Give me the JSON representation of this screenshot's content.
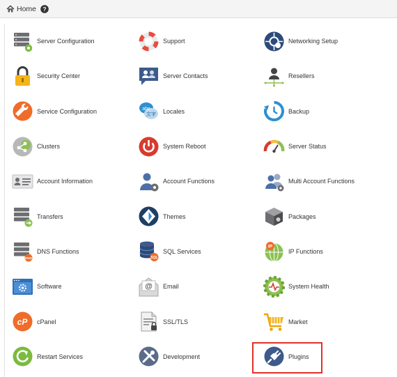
{
  "breadcrumb": {
    "home_label": "Home"
  },
  "highlight_color": "#e32f26",
  "tiles": [
    {
      "label": "Server Configuration",
      "icon": "server-config-icon"
    },
    {
      "label": "Support",
      "icon": "lifebuoy-icon"
    },
    {
      "label": "Networking Setup",
      "icon": "networking-icon"
    },
    {
      "label": "Security Center",
      "icon": "padlock-icon"
    },
    {
      "label": "Server Contacts",
      "icon": "contacts-chat-icon"
    },
    {
      "label": "Resellers",
      "icon": "resellers-icon"
    },
    {
      "label": "Service Configuration",
      "icon": "wrench-icon"
    },
    {
      "label": "Locales",
      "icon": "locales-icon"
    },
    {
      "label": "Backup",
      "icon": "backup-icon"
    },
    {
      "label": "Clusters",
      "icon": "clusters-icon"
    },
    {
      "label": "System Reboot",
      "icon": "power-icon"
    },
    {
      "label": "Server Status",
      "icon": "gauge-icon"
    },
    {
      "label": "Account Information",
      "icon": "account-card-icon"
    },
    {
      "label": "Account Functions",
      "icon": "user-gear-icon"
    },
    {
      "label": "Multi Account Functions",
      "icon": "multi-users-icon"
    },
    {
      "label": "Transfers",
      "icon": "transfers-icon"
    },
    {
      "label": "Themes",
      "icon": "themes-icon"
    },
    {
      "label": "Packages",
      "icon": "package-icon"
    },
    {
      "label": "DNS Functions",
      "icon": "dns-icon"
    },
    {
      "label": "SQL Services",
      "icon": "database-icon"
    },
    {
      "label": "IP Functions",
      "icon": "globe-ip-icon"
    },
    {
      "label": "Software",
      "icon": "software-window-icon"
    },
    {
      "label": "Email",
      "icon": "email-icon"
    },
    {
      "label": "System Health",
      "icon": "health-gear-icon"
    },
    {
      "label": "cPanel",
      "icon": "cpanel-icon"
    },
    {
      "label": "SSL/TLS",
      "icon": "certificate-icon"
    },
    {
      "label": "Market",
      "icon": "cart-icon"
    },
    {
      "label": "Restart Services",
      "icon": "restart-icon"
    },
    {
      "label": "Development",
      "icon": "development-tools-icon"
    },
    {
      "label": "Plugins",
      "icon": "plug-icon",
      "highlighted": true
    }
  ]
}
